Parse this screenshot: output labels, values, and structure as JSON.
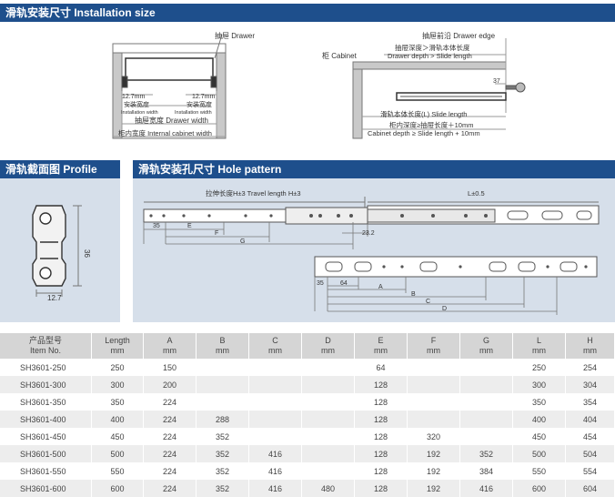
{
  "sections": {
    "installation": "滑轨安装尺寸   Installation size",
    "profile": "滑轨截面图  Profile",
    "hole": "滑轨安装孔尺寸  Hole pattern"
  },
  "install_left": {
    "drawer": "抽屉 Drawer",
    "dim_a": "12.7mm",
    "dim_b": "12.7mm",
    "install_width_cn": "安装宽度",
    "install_width_en": "Installation width",
    "drawer_width": "抽屉宽度 Drawer width",
    "cabinet_width": "柜内宽度 Internal cabinet width"
  },
  "install_right": {
    "drawer_edge": "抽屉前沿 Drawer edge",
    "drawer_depth_cn": "抽屉深度＞滑轨本体长度",
    "drawer_depth_en": "Drawer depth > Slide length",
    "cabinet": "柜 Cabinet",
    "dim_37": "37",
    "slide_length": "滑轨本体长度(L)  Slide length",
    "cabinet_depth_cn": "柜内深度≥抽屉长度＋10mm",
    "cabinet_depth_en": "Cabinet depth ≥ Slide length + 10mm"
  },
  "profile": {
    "height": "36",
    "width": "12.7"
  },
  "hole": {
    "travel": "拉伸长度H±3  Travel length H±3",
    "length": "L±0.5",
    "d35": "35",
    "dE": "E",
    "dF": "F",
    "dG": "G",
    "d23": "23.2",
    "d35b": "35",
    "d64": "64",
    "dA": "A",
    "dB": "B",
    "dC": "C",
    "dD": "D"
  },
  "table": {
    "headers": [
      [
        "产品型号",
        "Item No."
      ],
      [
        "Length",
        "mm"
      ],
      [
        "A",
        "mm"
      ],
      [
        "B",
        "mm"
      ],
      [
        "C",
        "mm"
      ],
      [
        "D",
        "mm"
      ],
      [
        "E",
        "mm"
      ],
      [
        "F",
        "mm"
      ],
      [
        "G",
        "mm"
      ],
      [
        "L",
        "mm"
      ],
      [
        "H",
        "mm"
      ]
    ],
    "rows": [
      [
        "SH3601-250",
        "250",
        "150",
        "",
        "",
        "",
        "64",
        "",
        "",
        "250",
        "254"
      ],
      [
        "SH3601-300",
        "300",
        "200",
        "",
        "",
        "",
        "128",
        "",
        "",
        "300",
        "304"
      ],
      [
        "SH3601-350",
        "350",
        "224",
        "",
        "",
        "",
        "128",
        "",
        "",
        "350",
        "354"
      ],
      [
        "SH3601-400",
        "400",
        "224",
        "288",
        "",
        "",
        "128",
        "",
        "",
        "400",
        "404"
      ],
      [
        "SH3601-450",
        "450",
        "224",
        "352",
        "",
        "",
        "128",
        "320",
        "",
        "450",
        "454"
      ],
      [
        "SH3601-500",
        "500",
        "224",
        "352",
        "416",
        "",
        "128",
        "192",
        "352",
        "500",
        "504"
      ],
      [
        "SH3601-550",
        "550",
        "224",
        "352",
        "416",
        "",
        "128",
        "192",
        "384",
        "550",
        "554"
      ],
      [
        "SH3601-600",
        "600",
        "224",
        "352",
        "416",
        "480",
        "128",
        "192",
        "416",
        "600",
        "604"
      ]
    ]
  }
}
